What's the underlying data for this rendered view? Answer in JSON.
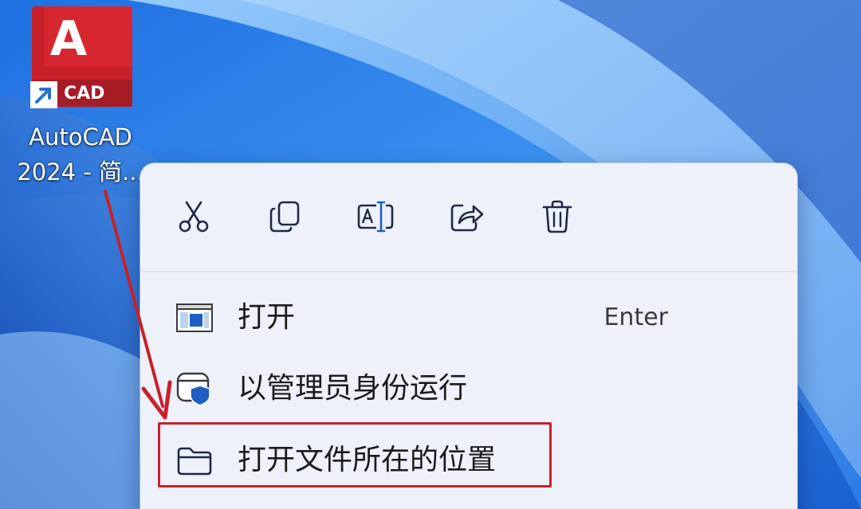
{
  "desktop": {
    "shortcut": {
      "tile_letter": "A",
      "tile_badge": "CAD",
      "label_line1": "AutoCAD",
      "label_line2": "2024 - 简..."
    }
  },
  "context_menu": {
    "toolbar": [
      {
        "name": "cut-button",
        "icon": "scissors-icon",
        "label": "Cut"
      },
      {
        "name": "copy-button",
        "icon": "copy-icon",
        "label": "Copy"
      },
      {
        "name": "rename-button",
        "icon": "rename-icon",
        "label": "Rename"
      },
      {
        "name": "share-button",
        "icon": "share-icon",
        "label": "Share"
      },
      {
        "name": "delete-button",
        "icon": "trash-icon",
        "label": "Delete"
      }
    ],
    "items": [
      {
        "label": "打开",
        "shortcut": "Enter",
        "icon": "app-window-icon"
      },
      {
        "label": "以管理员身份运行",
        "shortcut": "",
        "icon": "admin-shield-icon"
      },
      {
        "label": "打开文件所在的位置",
        "shortcut": "",
        "icon": "folder-icon"
      }
    ]
  },
  "colors": {
    "autocad_red": "#c8202a",
    "wallpaper_blue": "#2a7ee6",
    "menu_bg": "#eef1f9",
    "annotation_red": "#c8202a"
  }
}
